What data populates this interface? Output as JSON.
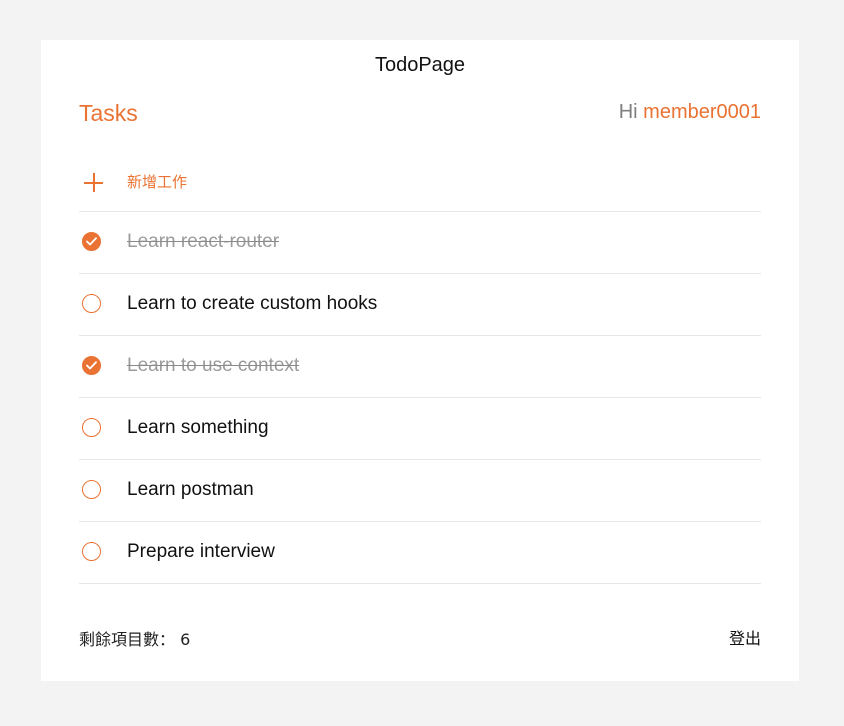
{
  "header": {
    "title": "TodoPage"
  },
  "section": {
    "heading": "Tasks",
    "greeting_prefix": "Hi",
    "username": "member0001"
  },
  "add_task": {
    "icon": "plus-icon",
    "label": "新增工作"
  },
  "tasks": [
    {
      "text": "Learn react-router",
      "completed": true
    },
    {
      "text": "Learn to create custom hooks",
      "completed": false
    },
    {
      "text": "Learn to use context",
      "completed": true
    },
    {
      "text": "Learn something",
      "completed": false
    },
    {
      "text": "Learn postman",
      "completed": false
    },
    {
      "text": "Prepare interview",
      "completed": false
    }
  ],
  "footer": {
    "remaining_label": "剩餘項目數：",
    "remaining_count": "6",
    "logout_label": "登出"
  },
  "colors": {
    "accent": "#ea7232",
    "background": "#f3f3f3",
    "card": "#ffffff",
    "divider": "#e6e6e6"
  }
}
